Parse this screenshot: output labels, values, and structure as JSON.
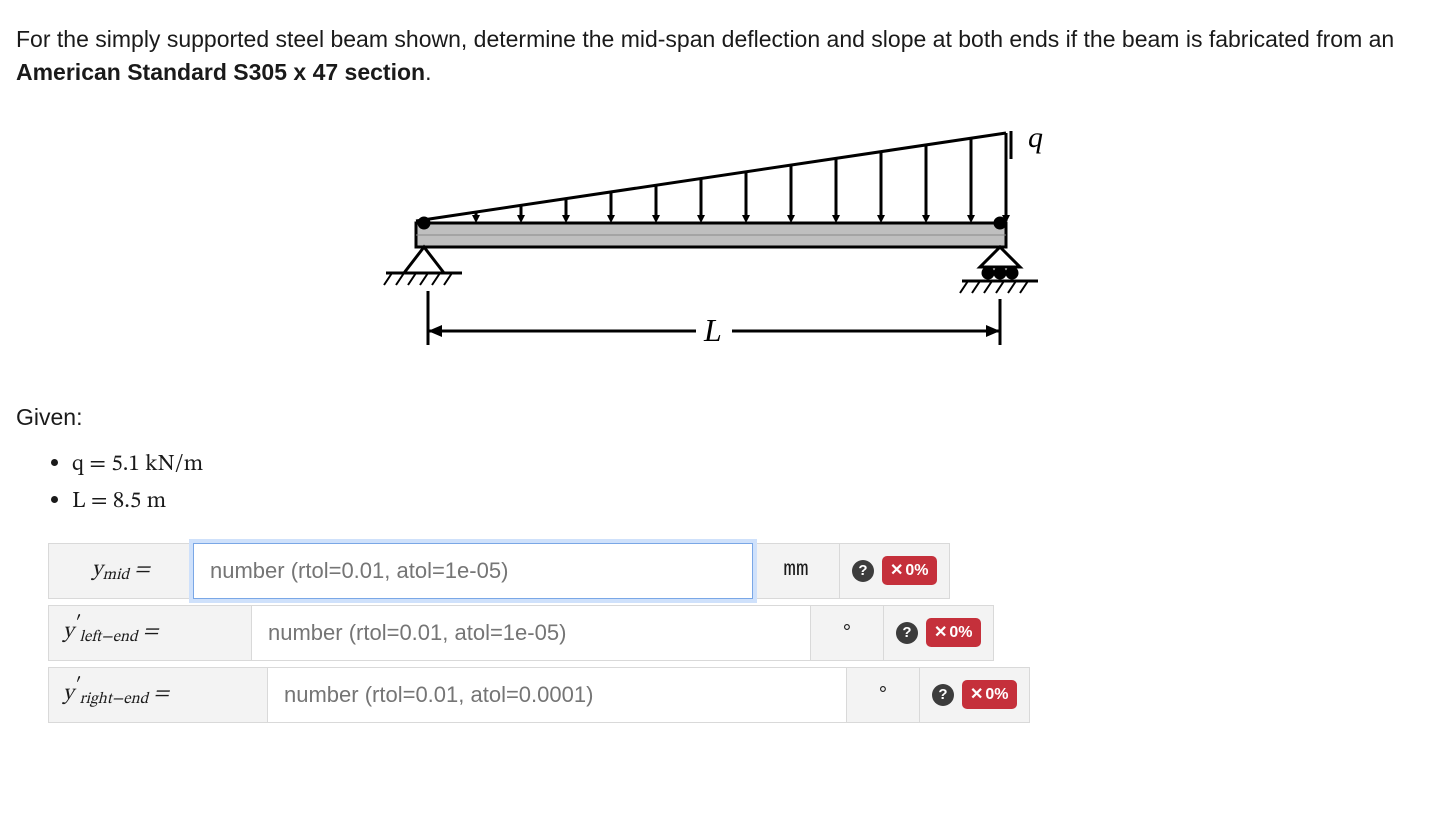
{
  "problem": {
    "text_before_bold": "For the simply supported steel beam shown, determine the mid-span deflection and slope at both ends if the beam is fabricated from an ",
    "bold_section": "American Standard S305 x 47 section",
    "text_after_bold": "."
  },
  "figure": {
    "load_label": "q",
    "span_label": "L"
  },
  "given_heading": "Given:",
  "given": {
    "q": {
      "symbol": "q",
      "value": "5.1",
      "unit": "kN/m"
    },
    "L": {
      "symbol": "L",
      "value": "8.5",
      "unit": "m"
    }
  },
  "answers": {
    "ymid": {
      "label_html": "y_mid",
      "placeholder": "number (rtol=0.01, atol=1e-05)",
      "value": "",
      "unit": "mm",
      "score": "0%"
    },
    "yleft": {
      "label_html": "y'_left-end",
      "placeholder": "number (rtol=0.01, atol=1e-05)",
      "value": "",
      "unit": "°",
      "score": "0%"
    },
    "yright": {
      "label_html": "y'_right-end",
      "placeholder": "number (rtol=0.01, atol=0.0001)",
      "value": "",
      "unit": "°",
      "score": "0%"
    }
  },
  "icons": {
    "help": "?",
    "wrong": "✕"
  }
}
